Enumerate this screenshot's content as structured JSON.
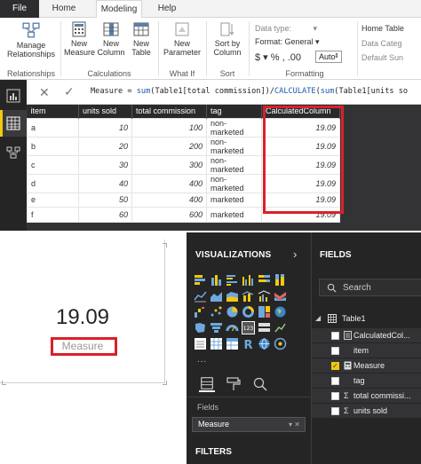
{
  "ribbon": {
    "tabs": [
      "File",
      "Home",
      "Modeling",
      "Help"
    ],
    "buttons": {
      "manage_relationships": "Manage Relationships",
      "new_measure": "New Measure",
      "new_column": "New Column",
      "new_table": "New Table",
      "new_parameter": "New Parameter",
      "sort_by_column": "Sort by Column"
    },
    "groups": {
      "relationships": "Relationships",
      "calculations": "Calculations",
      "what_if": "What If",
      "sort": "Sort",
      "formatting": "Formatting"
    },
    "formatting": {
      "data_type": "Data type:",
      "format": "Format: General",
      "symbols": "$ ▾ %  ,  .00",
      "auto": "Auto"
    },
    "properties": {
      "home_table": "Home Table",
      "data_category": "Data Categ",
      "default_summarization": "Default Sun"
    }
  },
  "formula": {
    "prefix": "Measure = ",
    "fn1": "sum",
    "mid": "(Table1[total commission])/",
    "fn2": "CALCULATE",
    "mid2": "(",
    "fn3": "sum",
    "tail": "(Table1[units so"
  },
  "table": {
    "columns": [
      "item",
      "units sold",
      "total commission",
      "tag",
      "CalculatedColumn"
    ],
    "rows": [
      [
        "a",
        "10",
        "100",
        "non-marketed",
        "19.09"
      ],
      [
        "b",
        "20",
        "200",
        "non-marketed",
        "19.09"
      ],
      [
        "c",
        "30",
        "300",
        "non-marketed",
        "19.09"
      ],
      [
        "d",
        "40",
        "400",
        "non-marketed",
        "19.09"
      ],
      [
        "e",
        "50",
        "400",
        "marketed",
        "19.09"
      ],
      [
        "f",
        "60",
        "600",
        "marketed",
        "19.09"
      ]
    ]
  },
  "card": {
    "value": "19.09",
    "label": "Measure"
  },
  "visualizations": {
    "title": "VISUALIZATIONS",
    "more": "...",
    "fields_label": "Fields",
    "well_value": "Measure",
    "filters_title": "FILTERS"
  },
  "fields_pane": {
    "title": "FIELDS",
    "search_placeholder": "Search",
    "table_name": "Table1",
    "items": [
      "CalculatedCol...",
      "item",
      "Measure",
      "tag",
      "total commissi...",
      "units sold"
    ]
  },
  "colors": {
    "accent_yellow": "#f2c811",
    "highlight_red": "#d9212b",
    "pane_dark": "#252526"
  }
}
